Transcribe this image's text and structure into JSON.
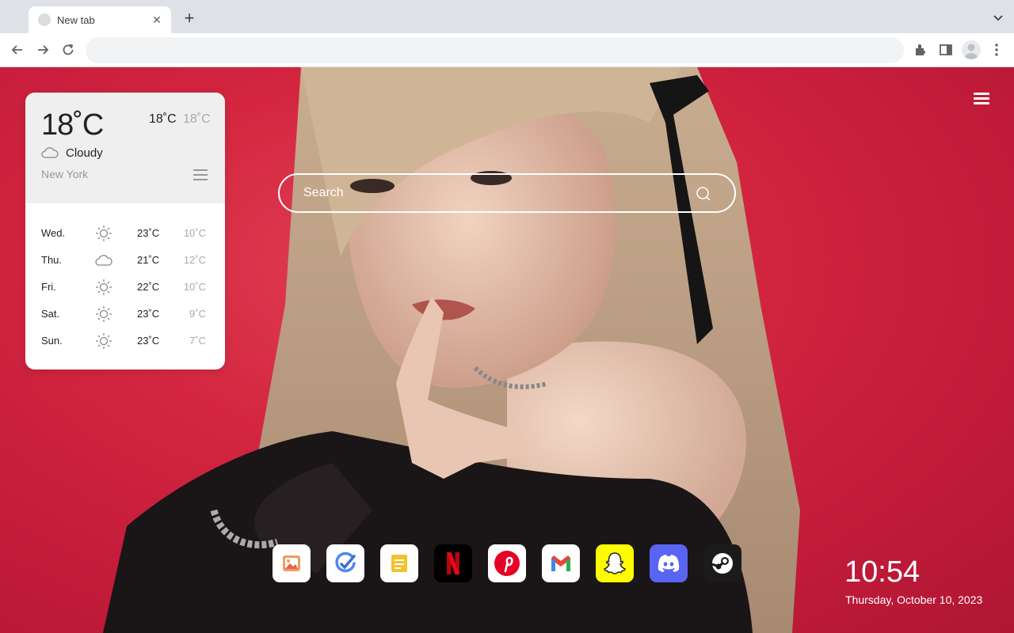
{
  "browser": {
    "tab_title": "New tab",
    "address_value": ""
  },
  "weather": {
    "current_temp": "18˚C",
    "high": "18˚C",
    "low": "18˚C",
    "condition": "Cloudy",
    "condition_icon": "cloud-icon",
    "city": "New York",
    "forecast": [
      {
        "day": "Wed.",
        "icon": "sun-icon",
        "high": "23˚C",
        "low": "10˚C"
      },
      {
        "day": "Thu.",
        "icon": "cloud-icon",
        "high": "21˚C",
        "low": "12˚C"
      },
      {
        "day": "Fri.",
        "icon": "sun-icon",
        "high": "22˚C",
        "low": "10˚C"
      },
      {
        "day": "Sat.",
        "icon": "sun-icon",
        "high": "23˚C",
        "low": "9˚C"
      },
      {
        "day": "Sun.",
        "icon": "sun-icon",
        "high": "23˚C",
        "low": "7˚C"
      }
    ]
  },
  "search": {
    "placeholder": "Search"
  },
  "dock": [
    {
      "name": "photos-shortcut",
      "icon": "image-icon"
    },
    {
      "name": "tasks-shortcut",
      "icon": "task-check-icon"
    },
    {
      "name": "notes-shortcut",
      "icon": "note-icon"
    },
    {
      "name": "netflix-shortcut",
      "icon": "netflix-icon"
    },
    {
      "name": "pinterest-shortcut",
      "icon": "pinterest-icon"
    },
    {
      "name": "gmail-shortcut",
      "icon": "gmail-icon"
    },
    {
      "name": "snapchat-shortcut",
      "icon": "snapchat-icon"
    },
    {
      "name": "discord-shortcut",
      "icon": "discord-icon"
    },
    {
      "name": "steam-shortcut",
      "icon": "steam-icon"
    }
  ],
  "clock": {
    "time": "10:54",
    "date": "Thursday, October 10, 2023"
  },
  "colors": {
    "background_red": "#d42640",
    "netflix_red": "#e50914",
    "pinterest_red": "#e60023",
    "snapchat_yellow": "#fffc00",
    "discord_blurple": "#5865f2"
  }
}
